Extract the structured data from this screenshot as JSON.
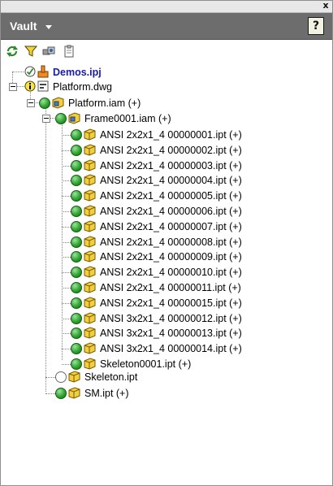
{
  "panel": {
    "close_label": "x",
    "title": "Vault",
    "help_label": "?"
  },
  "toolbar": {
    "icons": [
      "refresh-icon",
      "filter-icon",
      "show-details-icon",
      "clipboard-icon"
    ]
  },
  "tree": {
    "project": {
      "label": "Demos.ipj",
      "status": "checked-in"
    },
    "root": {
      "label": "Platform.dwg",
      "status": "info"
    },
    "assembly": {
      "label": "Platform.iam (+)",
      "status": "up-to-date"
    },
    "frame": {
      "label": "Frame0001.iam (+)",
      "status": "up-to-date"
    },
    "frame_children": [
      {
        "label": "ANSI 2x2x1_4 00000001.ipt (+)",
        "status": "up-to-date"
      },
      {
        "label": "ANSI 2x2x1_4 00000002.ipt (+)",
        "status": "up-to-date"
      },
      {
        "label": "ANSI 2x2x1_4 00000003.ipt (+)",
        "status": "up-to-date"
      },
      {
        "label": "ANSI 2x2x1_4 00000004.ipt (+)",
        "status": "up-to-date"
      },
      {
        "label": "ANSI 2x2x1_4 00000005.ipt (+)",
        "status": "up-to-date"
      },
      {
        "label": "ANSI 2x2x1_4 00000006.ipt (+)",
        "status": "up-to-date"
      },
      {
        "label": "ANSI 2x2x1_4 00000007.ipt (+)",
        "status": "up-to-date"
      },
      {
        "label": "ANSI 2x2x1_4 00000008.ipt (+)",
        "status": "up-to-date"
      },
      {
        "label": "ANSI 2x2x1_4 00000009.ipt (+)",
        "status": "up-to-date"
      },
      {
        "label": "ANSI 2x2x1_4 00000010.ipt (+)",
        "status": "up-to-date"
      },
      {
        "label": "ANSI 2x2x1_4 00000011.ipt (+)",
        "status": "up-to-date"
      },
      {
        "label": "ANSI 2x2x1_4 00000015.ipt (+)",
        "status": "up-to-date"
      },
      {
        "label": "ANSI 3x2x1_4 00000012.ipt (+)",
        "status": "up-to-date"
      },
      {
        "label": "ANSI 3x2x1_4 00000013.ipt (+)",
        "status": "up-to-date"
      },
      {
        "label": "ANSI 3x2x1_4 00000014.ipt (+)",
        "status": "up-to-date"
      },
      {
        "label": "Skeleton0001.ipt (+)",
        "status": "up-to-date"
      }
    ],
    "assembly_children": [
      {
        "label": "Skeleton.ipt",
        "status": "not-in-vault"
      },
      {
        "label": "SM.ipt (+)",
        "status": "up-to-date"
      }
    ]
  },
  "colors": {
    "header_bg": "#6d6d6d",
    "status_green": "#2fa52f",
    "project_label": "#1a1aa8",
    "cube_yellow": "#f2cf3c"
  }
}
